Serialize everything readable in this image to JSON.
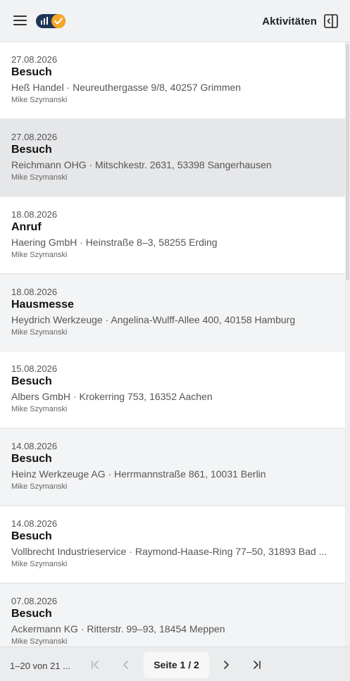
{
  "header": {
    "title": "Aktivitäten",
    "menu_icon": "hamburger-icon",
    "logo_icon": "app-logo-chart-check",
    "panel_icon": "panel-collapse-left-icon",
    "logo_colors": {
      "left": "#1d3557",
      "right": "#f5a623"
    }
  },
  "activities": [
    {
      "date": "27.08.2026",
      "type": "Besuch",
      "address": "Heß Handel · Neureuthergasse 9/8, 40257 Grimmen",
      "user": "Mike Szymanski"
    },
    {
      "date": "27.08.2026",
      "type": "Besuch",
      "address": "Reichmann OHG · Mitschkestr. 2631, 53398 Sangerhausen",
      "user": "Mike Szymanski"
    },
    {
      "date": "18.08.2026",
      "type": "Anruf",
      "address": "Haering GmbH · Heinstraße 8–3, 58255 Erding",
      "user": "Mike Szymanski"
    },
    {
      "date": "18.08.2026",
      "type": "Hausmesse",
      "address": "Heydrich Werkzeuge · Angelina-Wulff-Allee 400, 40158 Hamburg",
      "user": "Mike Szymanski"
    },
    {
      "date": "15.08.2026",
      "type": "Besuch",
      "address": "Albers GmbH · Krokerring 753, 16352 Aachen",
      "user": "Mike Szymanski"
    },
    {
      "date": "14.08.2026",
      "type": "Besuch",
      "address": "Heinz Werkzeuge AG · Herrmannstraße 861, 10031 Berlin",
      "user": "Mike Szymanski"
    },
    {
      "date": "14.08.2026",
      "type": "Besuch",
      "address": "Vollbrecht Industrieservice · Raymond-Haase-Ring 77–50, 31893 Bad ...",
      "user": "Mike Szymanski"
    },
    {
      "date": "07.08.2026",
      "type": "Besuch",
      "address": "Ackermann KG · Ritterstr. 99–93, 18454 Meppen",
      "user": "Mike Szymanski"
    }
  ],
  "pagination": {
    "range": "1–20 von 21 ...",
    "page_label": "Seite 1 / 2",
    "first_icon": "first-page-icon",
    "prev_icon": "prev-page-icon",
    "next_icon": "next-page-icon",
    "last_icon": "last-page-icon"
  }
}
